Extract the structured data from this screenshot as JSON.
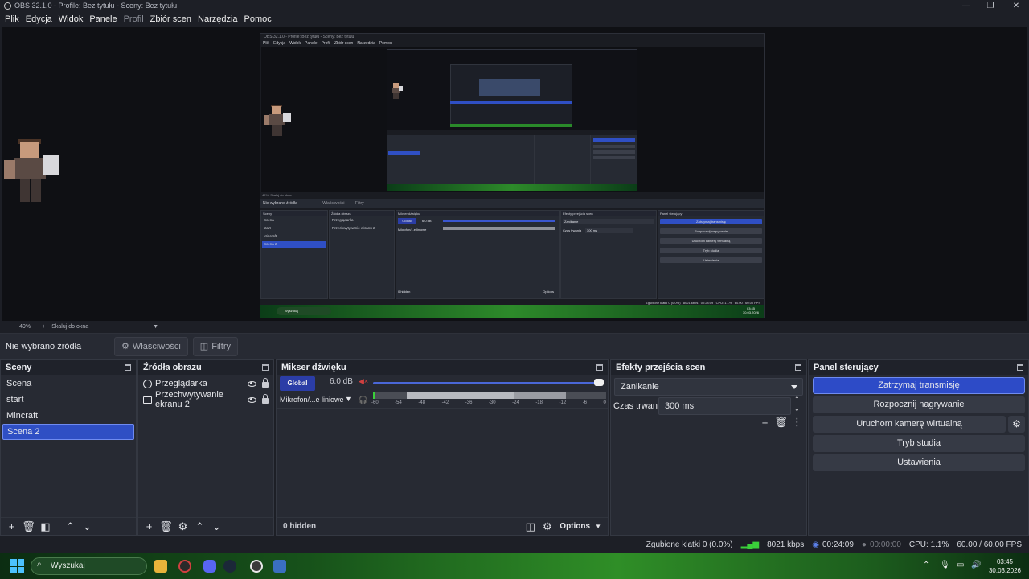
{
  "window": {
    "title": "OBS 32.1.0 - Profile: Bez tytułu - Sceny: Bez tytułu",
    "minimize": "—",
    "maximize": "❐",
    "close": "✕"
  },
  "menu": [
    "Plik",
    "Edycja",
    "Widok",
    "Panele",
    "Profil",
    "Zbiór scen",
    "Narzędzia",
    "Pomoc"
  ],
  "zoom": {
    "minus": "−",
    "value": "49%",
    "plus": "+",
    "mode": "Skaluj do okna"
  },
  "source_toolbar": {
    "no_source": "Nie wybrano źródła",
    "properties": "Właściwości",
    "filters": "Filtry"
  },
  "scenes": {
    "title": "Sceny",
    "items": [
      "Scena",
      "start",
      "Mincraft",
      "Scena 2"
    ],
    "selected": "Scena 2"
  },
  "sources": {
    "title": "Źródła obrazu",
    "items": [
      {
        "label": "Przeglądarka",
        "icon": "globe-icon"
      },
      {
        "label": "Przechwytywanie ekranu 2",
        "icon": "monitor-icon"
      }
    ]
  },
  "mixer": {
    "title": "Mikser dźwięku",
    "global_label": "Global",
    "global_db": "6.0 dB",
    "device": "Mikrofon/...e liniowe",
    "scale": [
      "-60",
      "-54",
      "-48",
      "-42",
      "-36",
      "-30",
      "-24",
      "-18",
      "-12",
      "-6",
      "0"
    ],
    "hidden": "0 hidden",
    "options": "Options"
  },
  "transitions": {
    "title": "Efekty przejścia scen",
    "selected": "Zanikanie",
    "duration_label": "Czas trwania",
    "duration": "300 ms"
  },
  "controls": {
    "title": "Panel sterujący",
    "buttons": [
      "Zatrzymaj transmisję",
      "Rozpocznij nagrywanie",
      "Uruchom kamerę wirtualną",
      "Tryb studia",
      "Ustawienia"
    ]
  },
  "status": {
    "dropped": "Zgubione klatki 0 (0.0%)",
    "bitrate": "8021 kbps",
    "stream_time": "00:24:09",
    "rec_time": "00:00:00",
    "cpu": "CPU: 1.1%",
    "fps": "60.00 / 60.00 FPS"
  },
  "taskbar": {
    "search": "Wyszukaj",
    "time": "03:45",
    "date": "30.03.2026"
  },
  "nested": {
    "title": "OBS 32.1.0 - Profile: Bez tytułu - Sceny: Bez tytułu",
    "menu": [
      "Plik",
      "Edycja",
      "Widok",
      "Panele",
      "Profil",
      "Zbiór scen",
      "Narzędzia",
      "Pomoc"
    ],
    "zoom": "49%",
    "zoom_mode": "Skaluj do okna",
    "no_source": "Nie wybrano źródła",
    "properties": "Właściwości",
    "filters": "Filtry",
    "scenes_title": "Sceny",
    "scenes": [
      "Scena",
      "start",
      "Mincraft",
      "Scena 2"
    ],
    "sources_title": "Źródła obrazu",
    "sources": [
      "Przeglądarka",
      "Przechwytywanie ekranu 2"
    ],
    "mixer_title": "Mikser dźwięku",
    "global": "Global",
    "global_db": "6.0 dB",
    "device": "Mikrofon/...e liniowe",
    "hidden": "0 hidden",
    "options": "Options",
    "transitions_title": "Efekty przejścia scen",
    "transition": "Zanikanie",
    "duration_label": "Czas trwania",
    "duration": "300 ms",
    "controls_title": "Panel sterujący",
    "controls": [
      "Zatrzymaj transmisję",
      "Rozpocznij nagrywanie",
      "Uruchom kamerę wirtualną",
      "Tryb studia",
      "Ustawienia"
    ],
    "status": "Zgubione klatki 0 (0.0%)",
    "bitrate": "8021 kbps",
    "stream_time": "00:24:09",
    "cpu": "CPU: 1.1%",
    "fps": "60.00 / 60.00 FPS",
    "search": "Wyszukaj",
    "time": "03:45",
    "date": "30.03.2026"
  },
  "colors": {
    "accent": "#2f4fc4",
    "panel": "#272a33",
    "background": "#1d1f26"
  }
}
